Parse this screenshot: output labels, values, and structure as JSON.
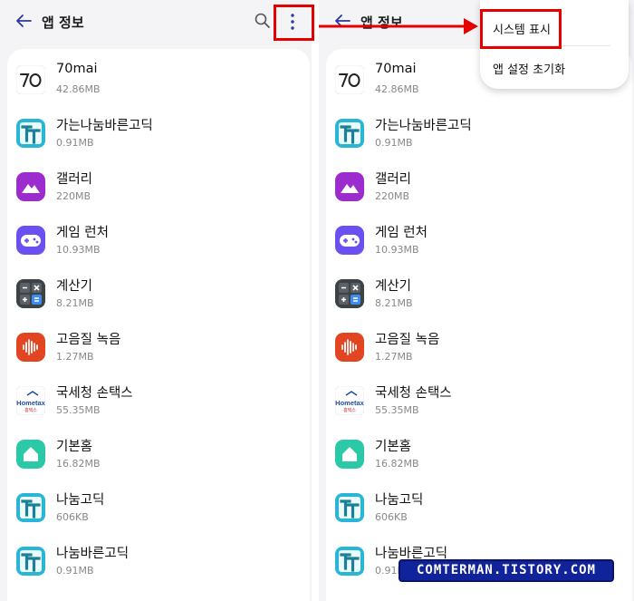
{
  "header": {
    "title": "앱 정보"
  },
  "menu": {
    "show_system": "시스템 표시",
    "reset_settings": "앱 설정 초기화"
  },
  "apps": [
    {
      "name": "70mai",
      "size": "42.86MB",
      "icon": "70mai-logo-icon"
    },
    {
      "name": "가는나눔바른고딕",
      "size": "0.91MB",
      "icon": "font-tt-icon"
    },
    {
      "name": "갤러리",
      "size": "220MB",
      "icon": "gallery-icon"
    },
    {
      "name": "게임 런처",
      "size": "10.93MB",
      "icon": "gamepad-icon"
    },
    {
      "name": "계산기",
      "size": "8.21MB",
      "icon": "calculator-icon"
    },
    {
      "name": "고음질 녹음",
      "size": "1.27MB",
      "icon": "voice-recorder-icon"
    },
    {
      "name": "국세청 손택스",
      "size": "55.35MB",
      "icon": "hometax-icon"
    },
    {
      "name": "기본홈",
      "size": "16.82MB",
      "icon": "home-icon"
    },
    {
      "name": "나눔고딕",
      "size": "606KB",
      "icon": "font-tt-icon"
    },
    {
      "name": "나눔바른고딕",
      "size": "0.91MB",
      "icon": "font-tt-icon"
    }
  ],
  "hometax_logo_text": "Hometax",
  "hometax_logo_subtext": "홈택스",
  "watermark": "COMTERMAN.TISTORY.COM",
  "colors": {
    "annotation_red": "#e40000",
    "accent_blue": "#2f4ad8",
    "watermark_bg": "#10239a"
  }
}
